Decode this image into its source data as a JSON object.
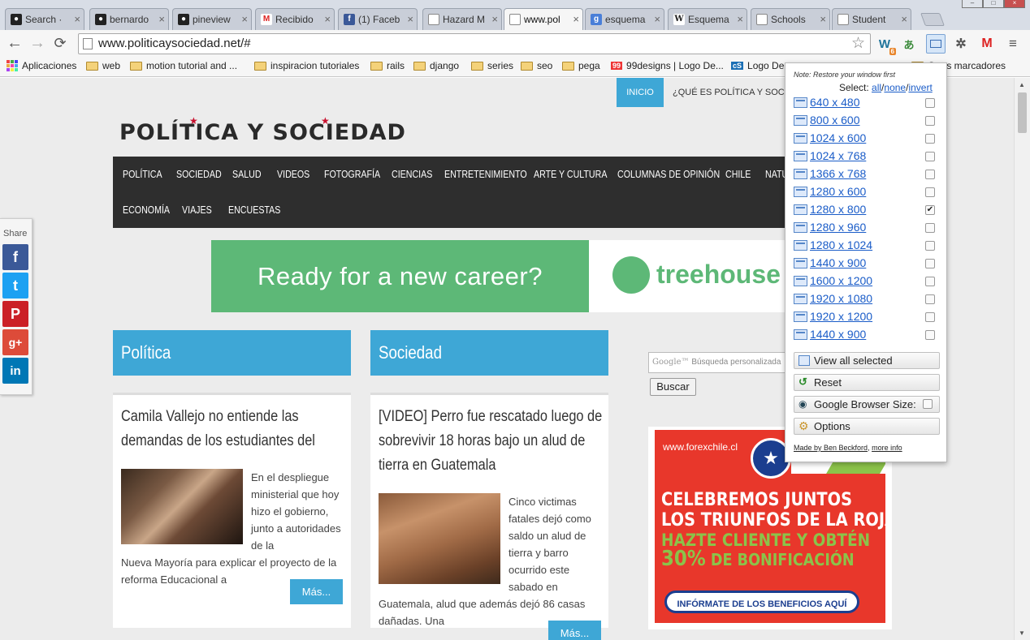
{
  "tabs": [
    {
      "title": "Search · ",
      "icon": "github-icon",
      "active": false
    },
    {
      "title": "bernardo",
      "icon": "github-icon",
      "active": false
    },
    {
      "title": "pineview",
      "icon": "github-icon",
      "active": false
    },
    {
      "title": "Recibido",
      "icon": "gmail-icon",
      "active": false
    },
    {
      "title": "(1) Faceb",
      "icon": "facebook-icon",
      "active": false
    },
    {
      "title": "Hazard M",
      "icon": "page-icon",
      "active": false
    },
    {
      "title": "www.pol",
      "icon": "page-icon",
      "active": true
    },
    {
      "title": "esquema",
      "icon": "google-icon",
      "active": false
    },
    {
      "title": "Esquema",
      "icon": "wikipedia-icon",
      "active": false
    },
    {
      "title": "Schools",
      "icon": "page-icon",
      "active": false
    },
    {
      "title": "Student",
      "icon": "page-icon",
      "active": false
    }
  ],
  "toolbar": {
    "url": "www.politicaysociedad.net/#",
    "extension_badge": "6"
  },
  "bookmarks": [
    {
      "label": "Aplicaciones",
      "icon": "apps-grid-icon"
    },
    {
      "label": "web",
      "icon": "folder-icon"
    },
    {
      "label": "motion tutorial and ...",
      "icon": "folder-icon"
    },
    {
      "label": "inspiracion tutoriales",
      "icon": "folder-icon"
    },
    {
      "label": "rails",
      "icon": "folder-icon"
    },
    {
      "label": "django",
      "icon": "folder-icon"
    },
    {
      "label": "series",
      "icon": "folder-icon"
    },
    {
      "label": "seo",
      "icon": "folder-icon"
    },
    {
      "label": "pega",
      "icon": "folder-icon"
    },
    {
      "label": "99designs | Logo De...",
      "icon": "99designs-icon",
      "badge": "99"
    },
    {
      "label": "Logo De",
      "icon": "cs-icon",
      "badge": "cS"
    },
    {
      "label": "Otros marcadores",
      "icon": "folder-icon"
    }
  ],
  "site": {
    "topnav": {
      "inicio": "INICIO",
      "que_es": "¿QUÉ ES POLÍTICA Y SOCIE"
    },
    "logo": "POLÍTICA Y SOCIEDAD",
    "nav_row1": [
      "POLÍTICA",
      "SOCIEDAD",
      "SALUD",
      "VIDEOS",
      "FOTOGRAFÍA",
      "CIENCIAS",
      "ENTRETENIMIENTO",
      "ARTE Y CULTURA",
      "COLUMNAS DE OPINIÓN",
      "CHILE",
      "NATU"
    ],
    "nav_row2": [
      "ECONOMÍA",
      "VIAJES",
      "ENCUESTAS"
    ],
    "banner": {
      "text": "Ready for a new career?",
      "brand": "treehouse"
    },
    "share": {
      "label": "Share",
      "buttons": [
        "f",
        "t",
        "P",
        "g+",
        "in"
      ]
    },
    "categories": [
      "Política",
      "Sociedad"
    ],
    "articles": [
      {
        "title": "Camila Vallejo no entiende las demandas de los estudiantes del Instituto Nacional",
        "text_side": "En el despliegue ministerial que hoy hizo el gobierno, junto a autoridades de la",
        "text_full": "Nueva Mayoría para explicar el proyecto de la reforma Educacional a",
        "more": "Más..."
      },
      {
        "title": "[VIDEO] Perro fue rescatado luego de sobrevivir 18 horas bajo un alud de tierra en Guatemala",
        "text_side": "Cinco victimas fatales dejó como saldo un alud de tierra y barro ocurrido este sabado en",
        "text_full": "Guatemala, alud que además dejó 86 casas dañadas. Una",
        "more": "Más..."
      }
    ],
    "search": {
      "brand": "Google™",
      "placeholder": "Búsqueda personalizada",
      "button": "Buscar"
    },
    "ad": {
      "url": "www.forexchile.cl",
      "line1": "CELEBREMOS JUNTOS",
      "line2": "LOS TRIUNFOS DE LA ROJA",
      "line3": "HAZTE CLIENTE Y OBTÉN",
      "line4_pct": "30%",
      "line4_rest": " DE BONIFICACIÓN",
      "cta": "INFÓRMATE DE LOS BENEFICIOS AQUÍ",
      "colors": {
        "bg": "#e8372b",
        "green": "#8bc34a",
        "blue": "#1b3e8f"
      }
    }
  },
  "popup": {
    "note": "Note: Restore your window first",
    "select_label": "Select: ",
    "select_all": "all",
    "select_none": "none",
    "select_invert": "invert",
    "sep": "/",
    "resolutions": [
      {
        "label": "640 x 480",
        "checked": false
      },
      {
        "label": "800 x 600",
        "checked": false
      },
      {
        "label": "1024 x 600",
        "checked": false
      },
      {
        "label": "1024 x 768",
        "checked": false
      },
      {
        "label": "1366 x 768",
        "checked": false
      },
      {
        "label": "1280 x 600",
        "checked": false
      },
      {
        "label": "1280 x 800",
        "checked": true
      },
      {
        "label": "1280 x 960",
        "checked": false
      },
      {
        "label": "1280 x 1024",
        "checked": false
      },
      {
        "label": "1440 x 900",
        "checked": false
      },
      {
        "label": "1600 x 1200",
        "checked": false
      },
      {
        "label": "1920 x 1080",
        "checked": false
      },
      {
        "label": "1920 x 1200",
        "checked": false
      },
      {
        "label": "1440 x 900",
        "checked": false
      }
    ],
    "view_all": "View all selected",
    "reset": "Reset",
    "google_size": "Google Browser Size:",
    "options": "Options",
    "footer_made": "Made by Ben Beckford",
    "footer_sep": ", ",
    "footer_more": "more info"
  },
  "colors": {
    "accent": "#3ea7d6",
    "nav_bg": "#2e2e2e",
    "link": "#1a5cc8",
    "treehouse_green": "#5db877"
  }
}
